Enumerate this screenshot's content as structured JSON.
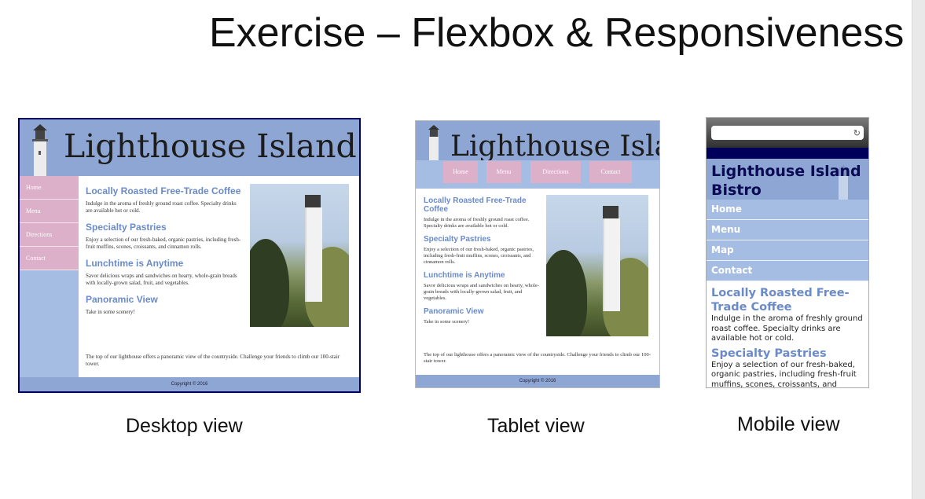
{
  "slide": {
    "title": "Exercise – Flexbox & Responsiveness",
    "captions": {
      "desktop": "Desktop view",
      "tablet": "Tablet view",
      "mobile": "Mobile view"
    }
  },
  "site": {
    "name": "Lighthouse Island Bistro",
    "desktop_banner_text": "Lighthouse Island Bist",
    "tablet_banner_text": "Lighthouse Isla",
    "nav": [
      "Home",
      "Menu",
      "Directions",
      "Contact"
    ],
    "mobile_nav": [
      "Home",
      "Menu",
      "Map",
      "Contact"
    ],
    "sections": [
      {
        "heading": "Locally Roasted Free-Trade Coffee",
        "text": "Indulge in the aroma of freshly ground roast coffee. Specialty drinks are available hot or cold."
      },
      {
        "heading": "Specialty Pastries",
        "text": "Enjoy a selection of our fresh-baked, organic pastries, including fresh-fruit muffins, scones, croissants, and cinnamon rolls."
      },
      {
        "heading": "Lunchtime is Anytime",
        "text": "Savor delicious wraps and sandwiches on hearty, whole-grain breads with locally-grown salad, fruit, and vegetables."
      },
      {
        "heading": "Panoramic View",
        "text": "Take in some scenery!"
      }
    ],
    "panoramic_text2": "The top of our lighthouse offers a panoramic view of the countryside. Challenge your friends to climb our 100-stair tower.",
    "mobile_pastries_text": "Enjoy a selection of our fresh-baked, organic pastries, including fresh-fruit muffins, scones, croissants, and",
    "footer": "Copyright © 2016"
  },
  "icons": {
    "reload": "reload-icon",
    "lighthouse": "lighthouse-icon"
  },
  "colors": {
    "banner": "#8ea6d4",
    "nav_pink": "#dbb0c8",
    "nav_blue": "#a6bde3",
    "heading": "#6a8ac8",
    "dark_navy": "#00005a"
  }
}
